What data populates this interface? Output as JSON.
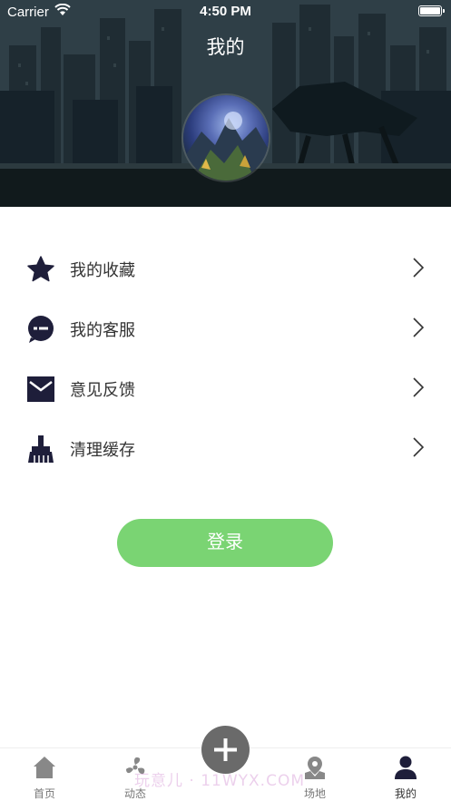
{
  "status_bar": {
    "carrier": "Carrier",
    "time": "4:50 PM"
  },
  "header": {
    "title": "我的"
  },
  "menu": {
    "items": [
      {
        "label": "我的收藏",
        "icon": "star-icon"
      },
      {
        "label": "我的客服",
        "icon": "chat-icon"
      },
      {
        "label": "意见反馈",
        "icon": "mail-icon"
      },
      {
        "label": "清理缓存",
        "icon": "broom-icon"
      }
    ]
  },
  "login": {
    "label": "登录"
  },
  "tabbar": {
    "tabs": [
      {
        "label": "首页",
        "icon": "home-icon"
      },
      {
        "label": "动态",
        "icon": "fan-icon"
      },
      {
        "label": "场地",
        "icon": "map-icon"
      },
      {
        "label": "我的",
        "icon": "user-icon"
      }
    ],
    "active_tab": "我的"
  },
  "watermark": "玩意儿 · 11WYX.COM",
  "colors": {
    "accent_green": "#7ad473",
    "icon_dark": "#1e1e3a",
    "tab_active": "#1e1e3a",
    "tab_inactive": "#888888"
  }
}
